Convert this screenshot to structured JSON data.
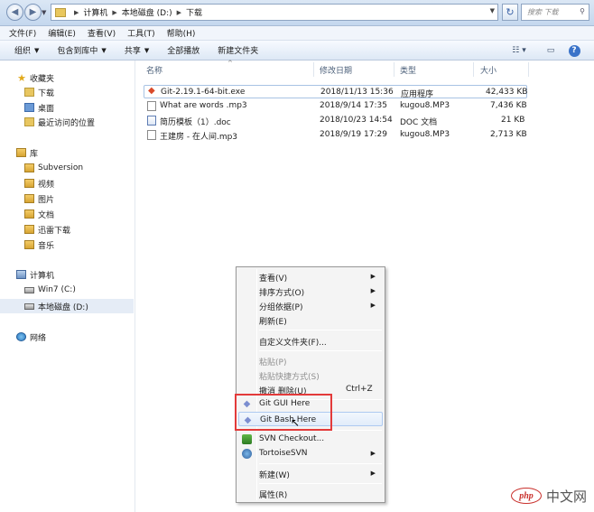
{
  "address": {
    "crumbs": [
      "计算机",
      "本地磁盘 (D:)",
      "下载"
    ],
    "search_placeholder": "搜索 下载"
  },
  "menubar": [
    "文件(F)",
    "编辑(E)",
    "查看(V)",
    "工具(T)",
    "帮助(H)"
  ],
  "toolbar": [
    "组织",
    "包含到库中",
    "共享",
    "全部播放",
    "新建文件夹"
  ],
  "sidebar": {
    "favorites": {
      "title": "收藏夹",
      "items": [
        "下载",
        "桌面",
        "最近访问的位置"
      ]
    },
    "libraries": {
      "title": "库",
      "items": [
        "Subversion",
        "视频",
        "图片",
        "文档",
        "迅雷下载",
        "音乐"
      ]
    },
    "computer": {
      "title": "计算机",
      "items": [
        "Win7 (C:)",
        "本地磁盘 (D:)"
      ]
    },
    "network": {
      "title": "网络"
    }
  },
  "columns": {
    "name": "名称",
    "date": "修改日期",
    "type": "类型",
    "size": "大小"
  },
  "files": [
    {
      "name": "Git-2.19.1-64-bit.exe",
      "date": "2018/11/13 15:36",
      "type": "应用程序",
      "size": "42,433 KB",
      "icon": "git-installer-icon"
    },
    {
      "name": "What are words .mp3",
      "date": "2018/9/14 17:35",
      "type": "kugou8.MP3",
      "size": "7,436 KB",
      "icon": "audio-file-icon"
    },
    {
      "name": "简历模板（1）.doc",
      "date": "2018/10/23 14:54",
      "type": "DOC 文档",
      "size": "21 KB",
      "icon": "doc-file-icon"
    },
    {
      "name": "王建房 - 在人间.mp3",
      "date": "2018/9/19 17:29",
      "type": "kugou8.MP3",
      "size": "2,713 KB",
      "icon": "audio-file-icon"
    }
  ],
  "context_menu": {
    "view": "查看(V)",
    "sort": "排序方式(O)",
    "group": "分组依据(P)",
    "refresh": "刷新(E)",
    "customize": "自定义文件夹(F)...",
    "paste": "粘贴(P)",
    "paste_shortcut": "粘贴快捷方式(S)",
    "undo": "撤消 删除(U)",
    "undo_shortcut": "Ctrl+Z",
    "git_gui": "Git GUI Here",
    "git_bash": "Git Bash Here",
    "svn_checkout": "SVN Checkout...",
    "tortoise": "TortoiseSVN",
    "new": "新建(W)",
    "properties": "属性(R)"
  },
  "watermark": {
    "logo": "php",
    "text": "中文网"
  },
  "colors": {
    "highlight_box": "#e33a3a",
    "selection": "#e5ecf6",
    "menu_hover_border": "#aecaf0"
  }
}
